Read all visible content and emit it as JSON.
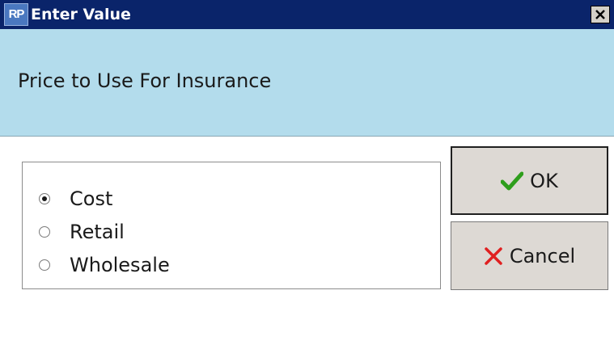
{
  "window": {
    "title": "Enter Value",
    "app_icon_text": "RP",
    "close_icon": "close-icon"
  },
  "prompt": "Price to Use For Insurance",
  "options": {
    "items": [
      {
        "label": "Cost",
        "checked": true
      },
      {
        "label": "Retail",
        "checked": false
      },
      {
        "label": "Wholesale",
        "checked": false
      }
    ]
  },
  "buttons": {
    "ok_label": "OK",
    "ok_icon": "checkmark-icon",
    "cancel_label": "Cancel",
    "cancel_icon": "x-icon"
  },
  "colors": {
    "titlebar": "#0a246a",
    "header_band": "#b3dcec",
    "ok_check": "#2e9e1c",
    "cancel_x": "#e02020"
  }
}
